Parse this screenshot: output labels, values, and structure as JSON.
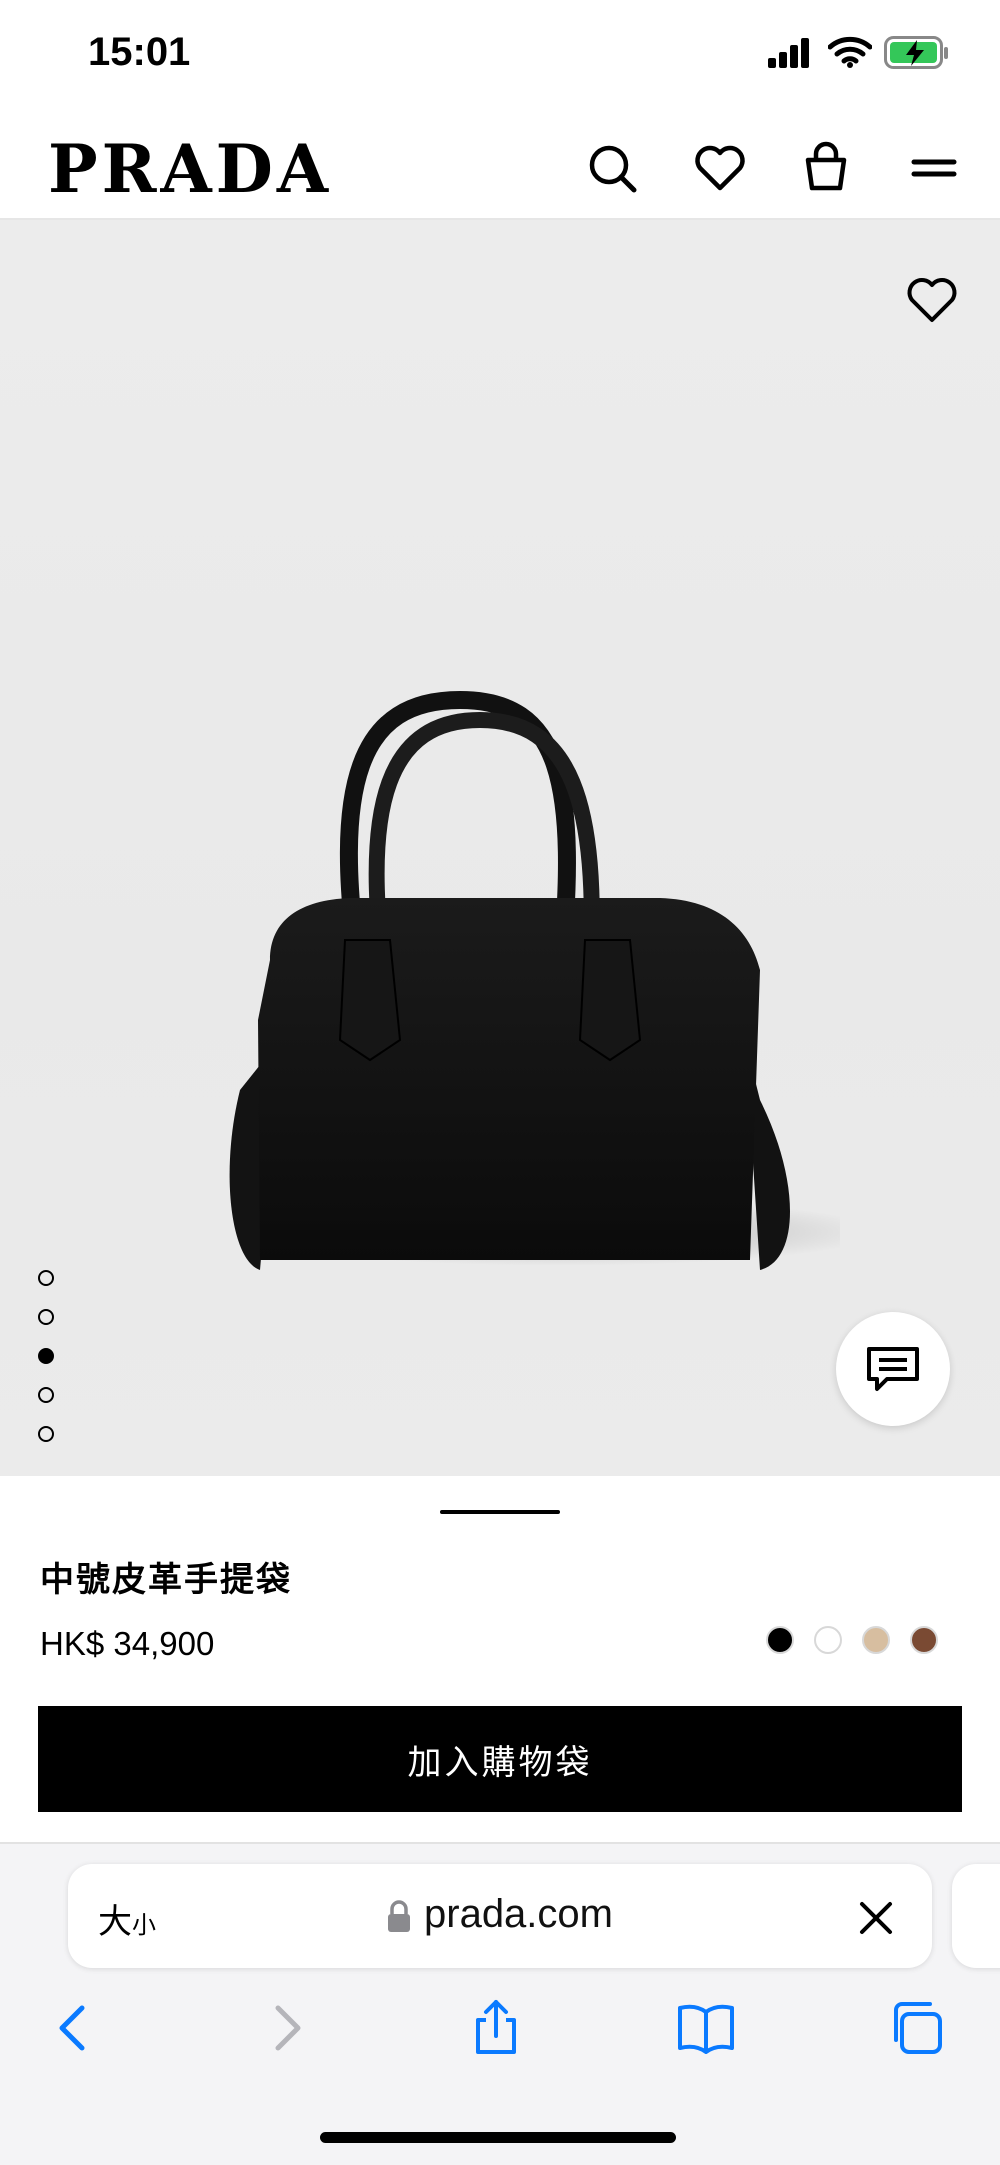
{
  "status": {
    "time": "15:01"
  },
  "header": {
    "brand": "PRADA",
    "icons": [
      "search-icon",
      "heart-icon",
      "shopping-bag-icon",
      "menu-icon"
    ]
  },
  "gallery": {
    "image_count": 5,
    "active_index": 2
  },
  "product": {
    "name": "中號皮革手提袋",
    "price": "HK$ 34,900",
    "colors": [
      "#000000",
      "#ffffff",
      "#d7bea0",
      "#7a4a33"
    ],
    "cta_label": "加入購物袋"
  },
  "safari": {
    "text_size_large": "大",
    "text_size_small": "小",
    "url": "prada.com"
  },
  "colors": {
    "accent": "#0a7aff",
    "primary": "#000000"
  }
}
